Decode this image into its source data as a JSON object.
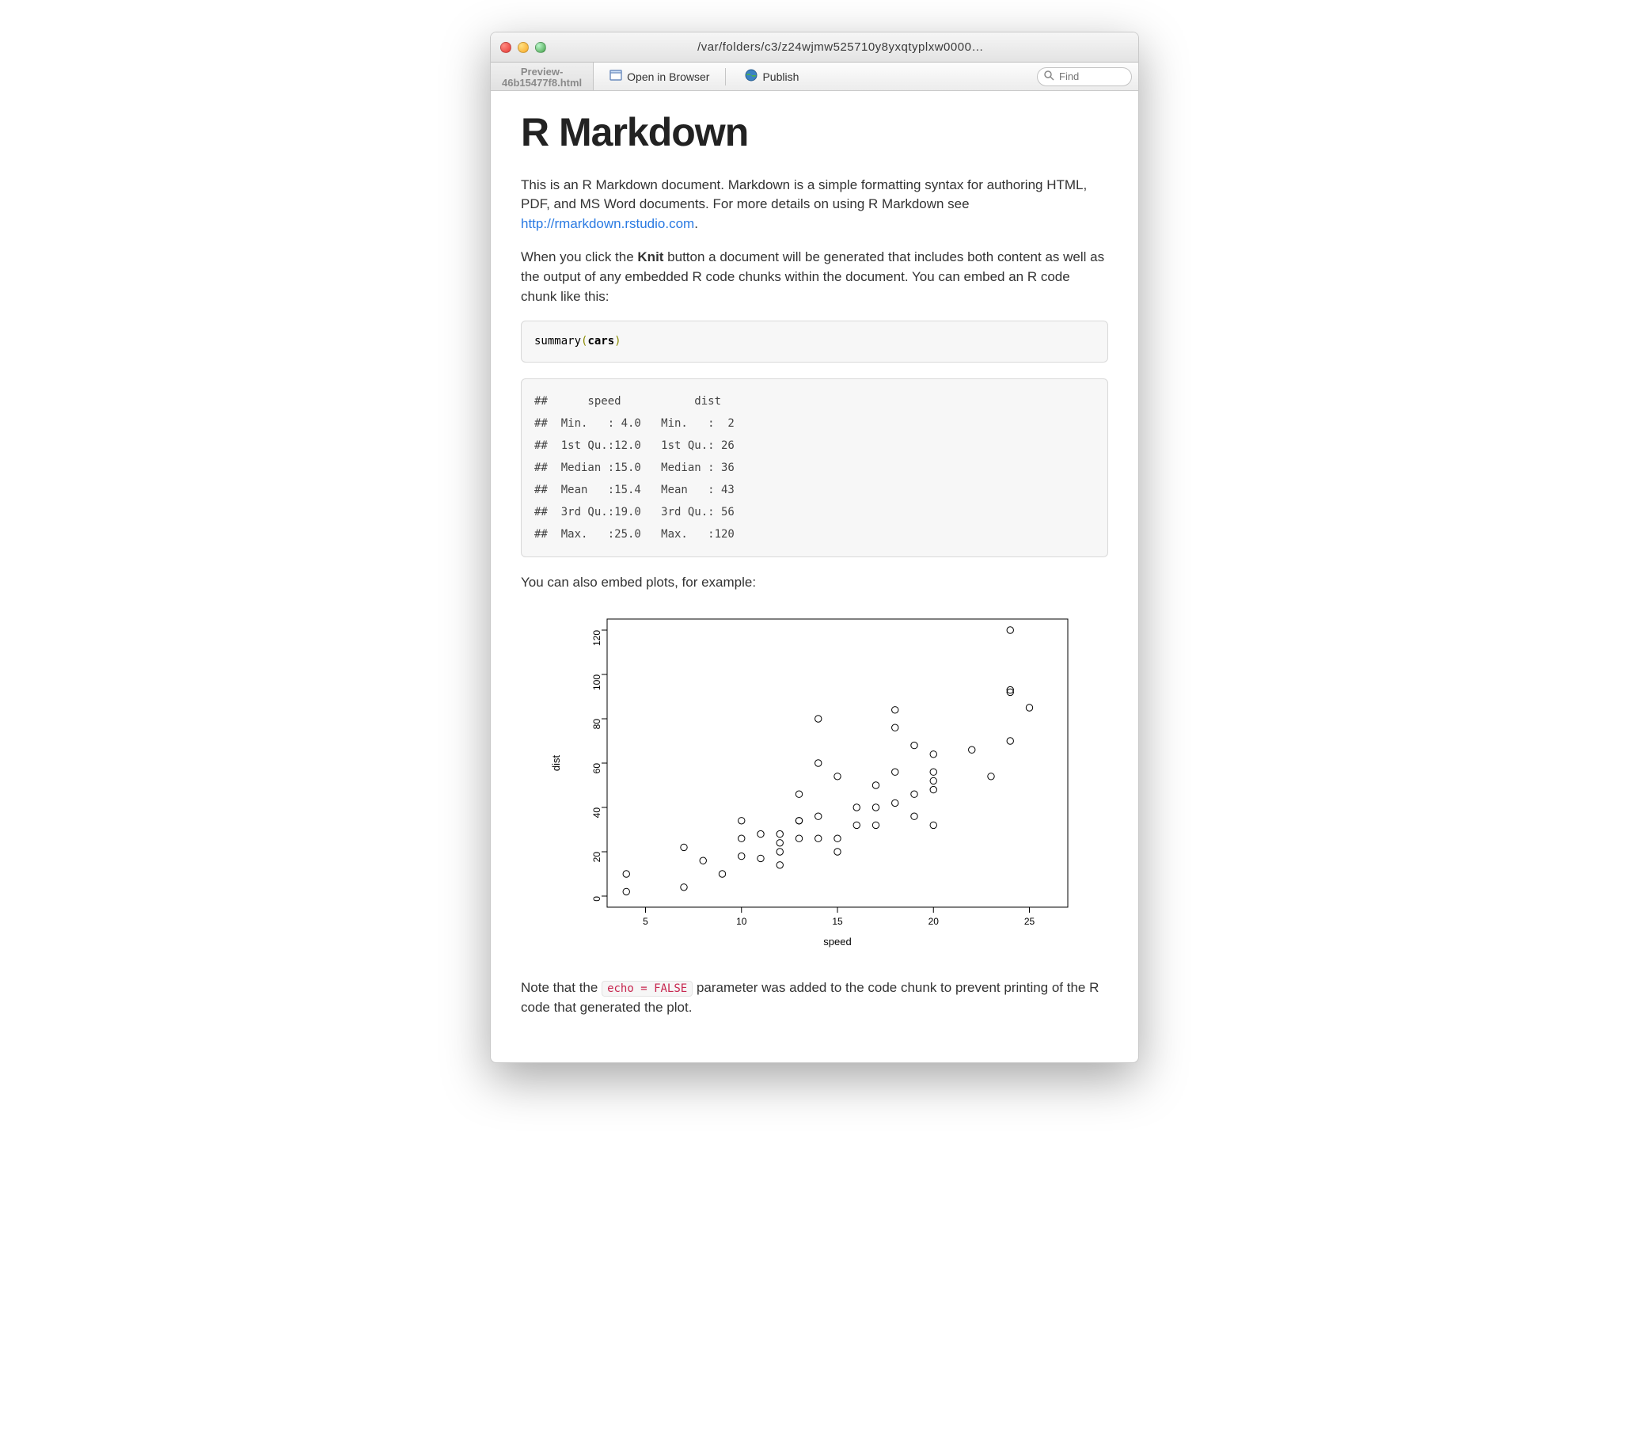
{
  "window": {
    "title_path": "/var/folders/c3/z24wjmw525710y8yxqtyplxw0000…"
  },
  "toolbar": {
    "tab_label": "Preview-\n46b15477f8.html",
    "open_in_browser": "Open in Browser",
    "publish": "Publish",
    "search_placeholder": "Find"
  },
  "doc": {
    "h1": "R Markdown",
    "p1a": "This is an R Markdown document. Markdown is a simple formatting syntax for authoring HTML, PDF, and MS Word documents. For more details on using R Markdown see ",
    "p1_link": "http://rmarkdown.rstudio.com",
    "p1b": ".",
    "p2a": "When you click the ",
    "p2_bold": "Knit",
    "p2b": " button a document will be generated that includes both content as well as the output of any embedded R code chunks within the document. You can embed an R code chunk like this:",
    "code_call_fn": "summary",
    "code_call_arg": "cars",
    "output_lines": [
      "##      speed           dist    ",
      "##  Min.   : 4.0   Min.   :  2  ",
      "##  1st Qu.:12.0   1st Qu.: 26  ",
      "##  Median :15.0   Median : 36  ",
      "##  Mean   :15.4   Mean   : 43  ",
      "##  3rd Qu.:19.0   3rd Qu.: 56  ",
      "##  Max.   :25.0   Max.   :120  "
    ],
    "p3": "You can also embed plots, for example:",
    "p4a": "Note that the ",
    "p4_code": "echo = FALSE",
    "p4b": " parameter was added to the code chunk to prevent printing of the R code that generated the plot."
  },
  "chart_data": {
    "type": "scatter",
    "xlabel": "speed",
    "ylabel": "dist",
    "xlim": [
      3,
      27
    ],
    "ylim": [
      -5,
      125
    ],
    "xticks": [
      5,
      10,
      15,
      20,
      25
    ],
    "yticks": [
      0,
      20,
      40,
      60,
      80,
      100,
      120
    ],
    "points": [
      {
        "x": 4,
        "y": 2
      },
      {
        "x": 4,
        "y": 10
      },
      {
        "x": 7,
        "y": 4
      },
      {
        "x": 7,
        "y": 22
      },
      {
        "x": 8,
        "y": 16
      },
      {
        "x": 9,
        "y": 10
      },
      {
        "x": 10,
        "y": 18
      },
      {
        "x": 10,
        "y": 26
      },
      {
        "x": 10,
        "y": 34
      },
      {
        "x": 11,
        "y": 17
      },
      {
        "x": 11,
        "y": 28
      },
      {
        "x": 12,
        "y": 14
      },
      {
        "x": 12,
        "y": 20
      },
      {
        "x": 12,
        "y": 24
      },
      {
        "x": 12,
        "y": 28
      },
      {
        "x": 13,
        "y": 26
      },
      {
        "x": 13,
        "y": 34
      },
      {
        "x": 13,
        "y": 34
      },
      {
        "x": 13,
        "y": 46
      },
      {
        "x": 14,
        "y": 26
      },
      {
        "x": 14,
        "y": 36
      },
      {
        "x": 14,
        "y": 60
      },
      {
        "x": 14,
        "y": 80
      },
      {
        "x": 15,
        "y": 20
      },
      {
        "x": 15,
        "y": 26
      },
      {
        "x": 15,
        "y": 54
      },
      {
        "x": 16,
        "y": 32
      },
      {
        "x": 16,
        "y": 40
      },
      {
        "x": 17,
        "y": 32
      },
      {
        "x": 17,
        "y": 40
      },
      {
        "x": 17,
        "y": 50
      },
      {
        "x": 18,
        "y": 42
      },
      {
        "x": 18,
        "y": 56
      },
      {
        "x": 18,
        "y": 76
      },
      {
        "x": 18,
        "y": 84
      },
      {
        "x": 19,
        "y": 36
      },
      {
        "x": 19,
        "y": 46
      },
      {
        "x": 19,
        "y": 68
      },
      {
        "x": 20,
        "y": 32
      },
      {
        "x": 20,
        "y": 48
      },
      {
        "x": 20,
        "y": 52
      },
      {
        "x": 20,
        "y": 56
      },
      {
        "x": 20,
        "y": 64
      },
      {
        "x": 22,
        "y": 66
      },
      {
        "x": 23,
        "y": 54
      },
      {
        "x": 24,
        "y": 70
      },
      {
        "x": 24,
        "y": 92
      },
      {
        "x": 24,
        "y": 93
      },
      {
        "x": 24,
        "y": 120
      },
      {
        "x": 25,
        "y": 85
      }
    ]
  }
}
